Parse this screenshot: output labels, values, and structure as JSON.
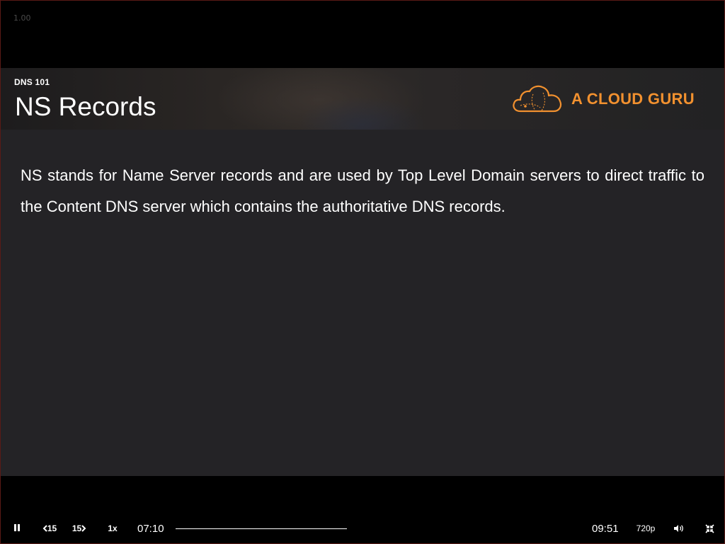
{
  "player": {
    "speed_readout": "1.00",
    "slide": {
      "course_label": "DNS 101",
      "title": "NS Records",
      "brand_name": "A CLOUD GURU",
      "brand_color": "#f2912f",
      "body": "NS stands for Name Server records and are used by Top Level Domain servers to direct traffic to the Content DNS server which contains the authoritative DNS records."
    },
    "controls": {
      "rewind_label": "15",
      "forward_label": "15",
      "rate_label": "1x",
      "elapsed": "07:10",
      "duration": "09:51",
      "progress_fraction": 1.0,
      "quality_label": "720p",
      "icons": [
        "pause-icon",
        "rewind-icon",
        "forward-icon",
        "volume-icon",
        "exit-fullscreen-icon"
      ]
    }
  }
}
